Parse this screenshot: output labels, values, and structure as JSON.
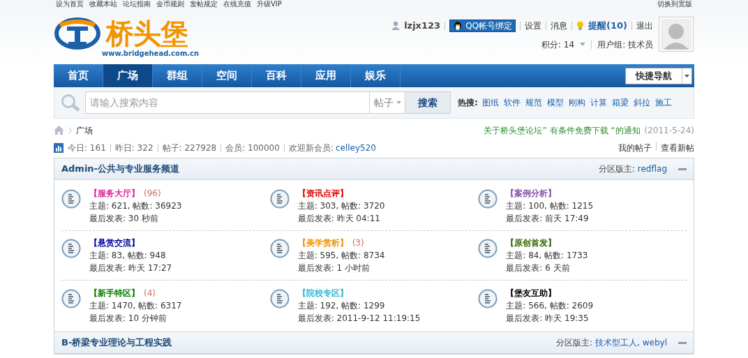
{
  "top_links": [
    "设为首页",
    "收藏本站",
    "论坛指南",
    "金币规则",
    "发帖规定",
    "在线充值",
    "升级VIP"
  ],
  "top_right": "切换到宽版",
  "logo": {
    "title": "桥头堡",
    "url": "www.bridgehead.com.cn"
  },
  "user": {
    "name": "lzjx123",
    "qq_button": "QQ帐号绑定",
    "links": [
      "设置",
      "消息"
    ],
    "reminder": "提醒(10)",
    "logout": "退出",
    "points": "积分: 14",
    "group": "用户组: 技术员"
  },
  "nav": [
    {
      "label": "首页",
      "selected": false
    },
    {
      "label": "广场",
      "selected": true
    },
    {
      "label": "群组",
      "selected": false
    },
    {
      "label": "空间",
      "selected": false
    },
    {
      "label": "百科",
      "selected": false
    },
    {
      "label": "应用",
      "selected": false
    },
    {
      "label": "娱乐",
      "selected": false
    }
  ],
  "quick_nav": "快捷导航",
  "search": {
    "placeholder": "请输入搜索内容",
    "type": "帖子",
    "button": "搜索",
    "hot_label": "热搜:",
    "hot": [
      "图纸",
      "软件",
      "规范",
      "模型",
      "刚构",
      "计算",
      "箱梁",
      "斜拉",
      "施工"
    ]
  },
  "breadcrumb": "广场",
  "notice": {
    "text": "关于桥头堡论坛” 有条件免费下载 “的通知",
    "date": "(2011-5-24)"
  },
  "stats": [
    "今日: 161",
    "昨日: 322",
    "帖子: 227928",
    "会员: 100000"
  ],
  "welcome": {
    "label": "欢迎新会员:",
    "name": "celley520"
  },
  "stat_links": [
    "我的帖子",
    "查看新帖"
  ],
  "sections": [
    {
      "title": "Admin-公共与专业服务频道",
      "moderator_label": "分区版主:",
      "moderators": "redflag",
      "expanded": true,
      "forums": [
        {
          "name": "【服务大厅】",
          "color": "#e0209a",
          "count": "(96)",
          "stats": "主题: 621, 帖数: 36923",
          "last": "最后发表: 30 秒前"
        },
        {
          "name": "【资讯点评】",
          "color": "#e00000",
          "stats": "主题: 303, 帖数: 3720",
          "last": "最后发表: 昨天 04:11"
        },
        {
          "name": "【案例分析】",
          "color": "#8050a8",
          "stats": "主题: 100, 帖数: 1215",
          "last": "最后发表: 前天 17:49"
        },
        {
          "name": "【悬赏交流】",
          "color": "#0000a0",
          "stats": "主题: 83, 帖数: 948",
          "last": "最后发表: 昨天 17:27"
        },
        {
          "name": "【美学赏析】",
          "color": "#f09000",
          "count": "(3)",
          "stats": "主题: 595, 帖数: 8734",
          "last": "最后发表: 1 小时前"
        },
        {
          "name": "【原创首发】",
          "color": "#336600",
          "stats": "主题: 84, 帖数: 1733",
          "last": "最后发表: 6 天前"
        },
        {
          "name": "【新手特区】",
          "color": "#008000",
          "count": "(4)",
          "stats": "主题: 1470, 帖数: 6317",
          "last": "最后发表: 10 分钟前"
        },
        {
          "name": "【院校专区】",
          "color": "#33b8d0",
          "stats": "主题: 192, 帖数: 1299",
          "last": "最后发表: 2011-9-12 11:19:15"
        },
        {
          "name": "【堡友互助】",
          "color": "#000000",
          "stats": "主题: 566, 帖数: 2609",
          "last": "最后发表: 昨天 19:35"
        }
      ]
    },
    {
      "title": "B-桥梁专业理论与工程实践",
      "moderator_label": "分区版主:",
      "moderators": "技术型工人, webyl",
      "expanded": true
    }
  ]
}
